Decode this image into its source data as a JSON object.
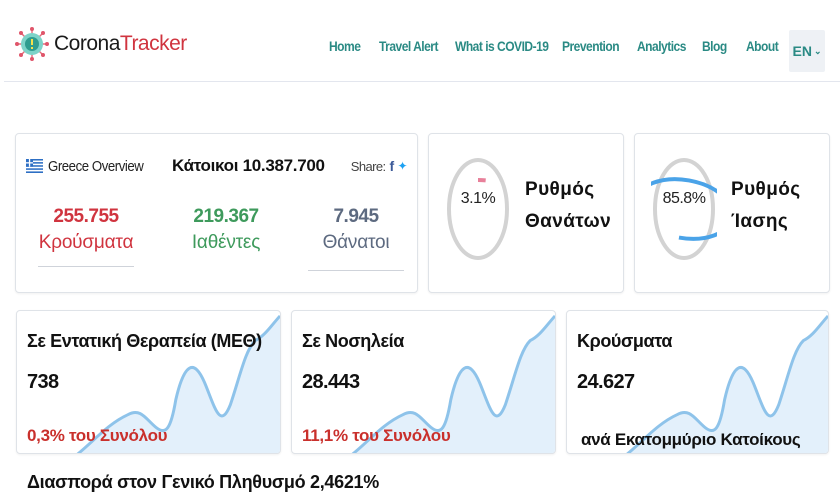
{
  "brand": {
    "name_part1": "Corona",
    "name_part2": "Tracker"
  },
  "nav": {
    "links": [
      "Home",
      "Travel Alert",
      "What is COVID-19",
      "Prevention",
      "Analytics",
      "Blog",
      "About"
    ],
    "language": "EN"
  },
  "overview": {
    "title": "Greece Overview",
    "population": "Κάτοικοι 10.387.700",
    "share_label": "Share:",
    "stats": [
      {
        "value": "255.755",
        "label": "Κρούσματα",
        "color": "#d0343f"
      },
      {
        "value": "219.367",
        "label": "Ιαθέντες",
        "color": "#3e9a5c"
      },
      {
        "value": "7.945",
        "label": "Θάνατοι",
        "color": "#5d6a80"
      }
    ]
  },
  "rates": {
    "death": {
      "percent": "3.1%",
      "fraction": 0.031,
      "title_line1": "Ρυθμός",
      "title_line2": "Θανάτων",
      "color": "#e8809a"
    },
    "recovery": {
      "percent": "85.8%",
      "fraction": 0.858,
      "title_line1": "Ρυθμός",
      "title_line2": "Ίασης",
      "color": "#4aa3e8"
    }
  },
  "trends": {
    "icu": {
      "title": "Σε Εντατική Θεραπεία (ΜΕΘ)",
      "value": "738",
      "note": "0,3% του Συνόλου"
    },
    "hospital": {
      "title": "Σε Νοσηλεία",
      "value": "28.443",
      "note": "11,1%   του Συνόλου"
    },
    "per_million": {
      "title": "Κρούσματα",
      "value": "24.627",
      "note": "ανά Εκατομμύριο Κατοίκους"
    }
  },
  "spread": "Διασπορά στον Γενικό Πληθυσμό  2,4621%",
  "colors": {
    "nav": "#2a8a84",
    "accent_red": "#d0343f",
    "spark": "#8ec3ea"
  }
}
